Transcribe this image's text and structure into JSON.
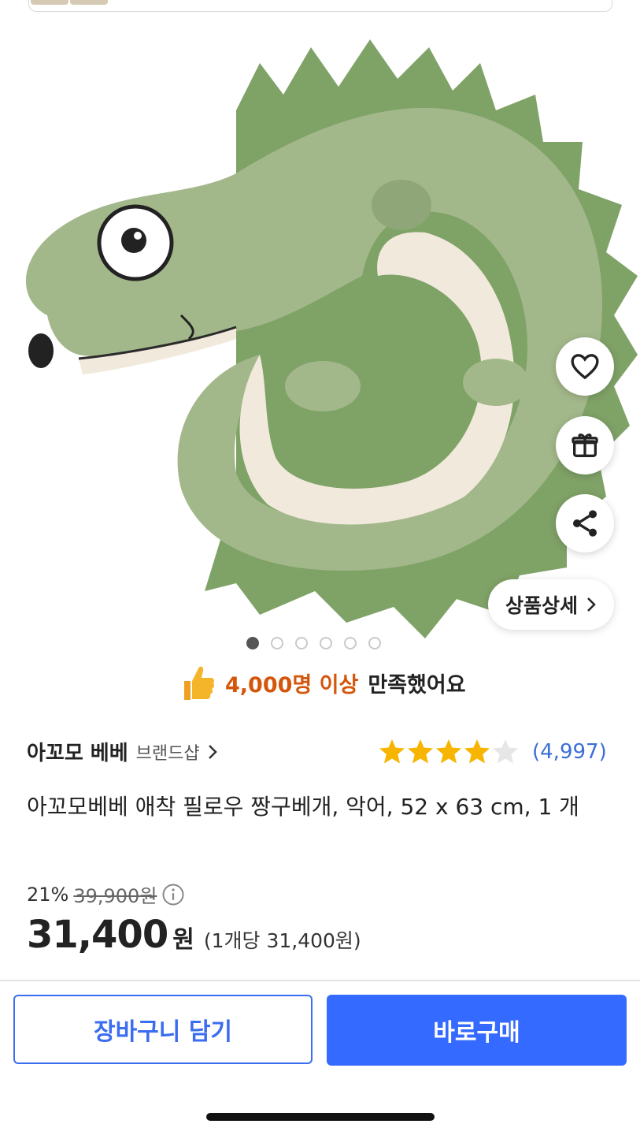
{
  "product": {
    "image_alt": "crocodile pillow",
    "image_dots": {
      "count": 6,
      "active_index": 0
    },
    "detail_button_label": "상품상세"
  },
  "satisfaction": {
    "highlight": "4,000명 이상",
    "text": "만족했어요"
  },
  "brand": {
    "name": "아꼬모 베베",
    "shop_label": "브랜드샵"
  },
  "rating": {
    "stars": 4.5,
    "count_text": "(4,997)"
  },
  "title": "아꼬모베베 애착 필로우 짱구베개, 악어, 52 x 63 cm, 1 개",
  "pricing": {
    "discount": "21%",
    "original_price": "39,900원",
    "price": "31,400",
    "currency": "원",
    "unit_price": "(1개당 31,400원)"
  },
  "actions": {
    "cart_label": "장바구니 담기",
    "buy_label": "바로구매"
  },
  "colors": {
    "accent_blue": "#346aff",
    "highlight_orange": "#d4560b",
    "star_yellow": "#f7b500"
  }
}
